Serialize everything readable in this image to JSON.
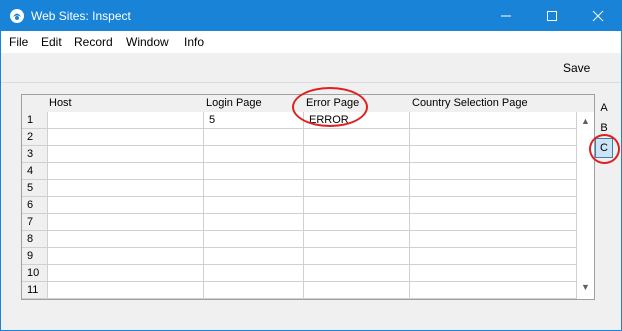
{
  "window": {
    "title": "Web Sites: Inspect",
    "titlebar_color": "#1883d7"
  },
  "menubar": {
    "items": [
      "File",
      "Edit",
      "Record",
      "Window",
      "Info"
    ]
  },
  "toolbar": {
    "save_label": "Save"
  },
  "grid": {
    "columns": [
      "",
      "Host",
      "Login Page",
      "Error Page",
      "Country Selection Page"
    ],
    "rows": [
      {
        "num": "1",
        "host": "",
        "login_page": "5",
        "error_page": "ERROR",
        "country_selection_page": ""
      },
      {
        "num": "2",
        "host": "",
        "login_page": "",
        "error_page": "",
        "country_selection_page": ""
      },
      {
        "num": "3",
        "host": "",
        "login_page": "",
        "error_page": "",
        "country_selection_page": ""
      },
      {
        "num": "4",
        "host": "",
        "login_page": "",
        "error_page": "",
        "country_selection_page": ""
      },
      {
        "num": "5",
        "host": "",
        "login_page": "",
        "error_page": "",
        "country_selection_page": ""
      },
      {
        "num": "6",
        "host": "",
        "login_page": "",
        "error_page": "",
        "country_selection_page": ""
      },
      {
        "num": "7",
        "host": "",
        "login_page": "",
        "error_page": "",
        "country_selection_page": ""
      },
      {
        "num": "8",
        "host": "",
        "login_page": "",
        "error_page": "",
        "country_selection_page": ""
      },
      {
        "num": "9",
        "host": "",
        "login_page": "",
        "error_page": "",
        "country_selection_page": ""
      },
      {
        "num": "10",
        "host": "",
        "login_page": "",
        "error_page": "",
        "country_selection_page": ""
      },
      {
        "num": "11",
        "host": "",
        "login_page": "",
        "error_page": "",
        "country_selection_page": ""
      }
    ]
  },
  "tabs": {
    "items": [
      "A",
      "B",
      "C"
    ],
    "active": "C"
  },
  "annotation_color": "#e02020"
}
